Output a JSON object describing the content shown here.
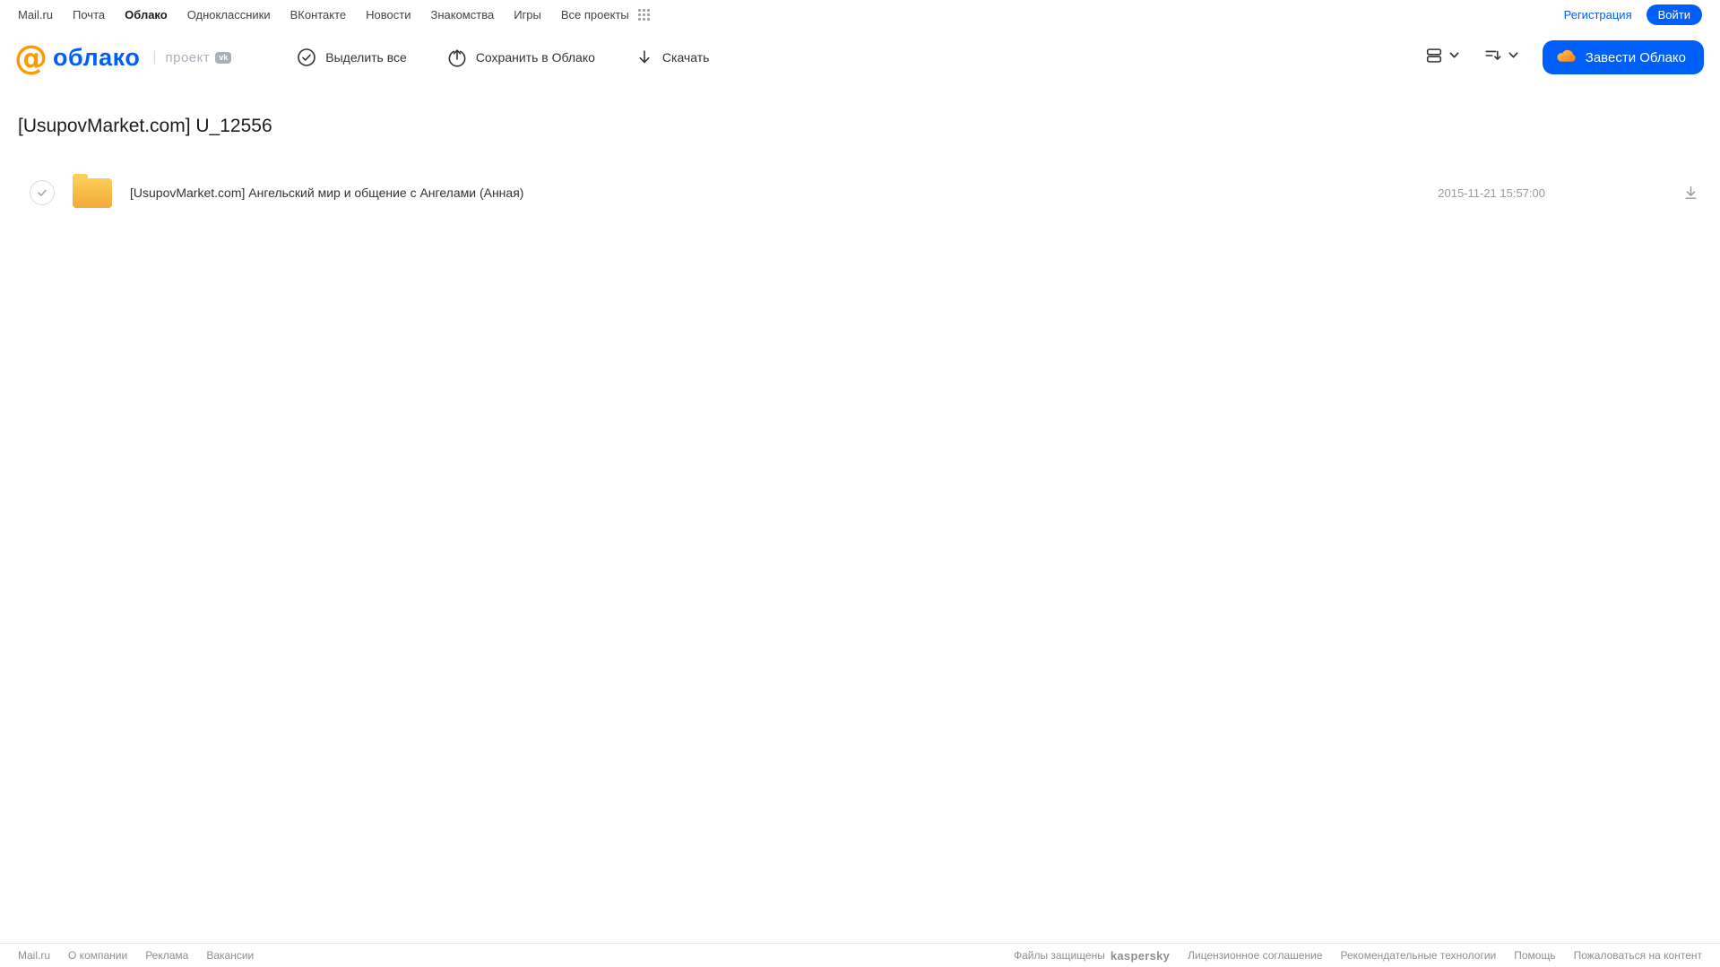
{
  "topnav": {
    "items": [
      "Mail.ru",
      "Почта",
      "Облако",
      "Одноклассники",
      "ВКонтакте",
      "Новости",
      "Знакомства",
      "Игры",
      "Все проекты"
    ],
    "registration_label": "Регистрация",
    "login_label": "Войти"
  },
  "header": {
    "logo_at": "@",
    "logo_text": "облако",
    "project_label": "проект",
    "vk_badge_text": "vk",
    "actions": {
      "select_all": "Выделить все",
      "save_to_cloud": "Сохранить в Облако",
      "download": "Скачать"
    },
    "get_cloud_button": "Завести Облако"
  },
  "main": {
    "title": "[UsupovMarket.com] U_12556",
    "files": [
      {
        "type": "folder",
        "name": "[UsupovMarket.com] Ангельский мир и общение с Ангелами (Анная)",
        "date": "2015-11-21 15:57:00"
      }
    ]
  },
  "footer": {
    "left_links": [
      "Mail.ru",
      "О компании",
      "Реклама",
      "Вакансии"
    ],
    "protected_label": "Файлы защищены",
    "kaspersky_logo": "kaspersky",
    "right_links": [
      "Лицензионное соглашение",
      "Рекомендательные технологии",
      "Помощь",
      "Пожаловаться на контент"
    ]
  },
  "icons": {
    "select_all": "check-circle-icon",
    "save_to_cloud": "cloud-upload-icon",
    "download": "arrow-down-icon",
    "view_mode": "list-view-icon",
    "sort": "sort-icon",
    "apps": "grid-dots-icon",
    "cloud": "cloud-icon",
    "row_download": "download-icon",
    "checkbox": "check-icon"
  },
  "colors": {
    "accent_blue": "#005ff9",
    "logo_orange": "#ff9900",
    "kaspersky_green": "#00a88e",
    "folder_top": "#fcce57",
    "folder_bottom": "#f3a93a",
    "text_dark": "#333333",
    "text_gray": "#9b9b9b",
    "footer_gray": "#8f8f8f"
  }
}
